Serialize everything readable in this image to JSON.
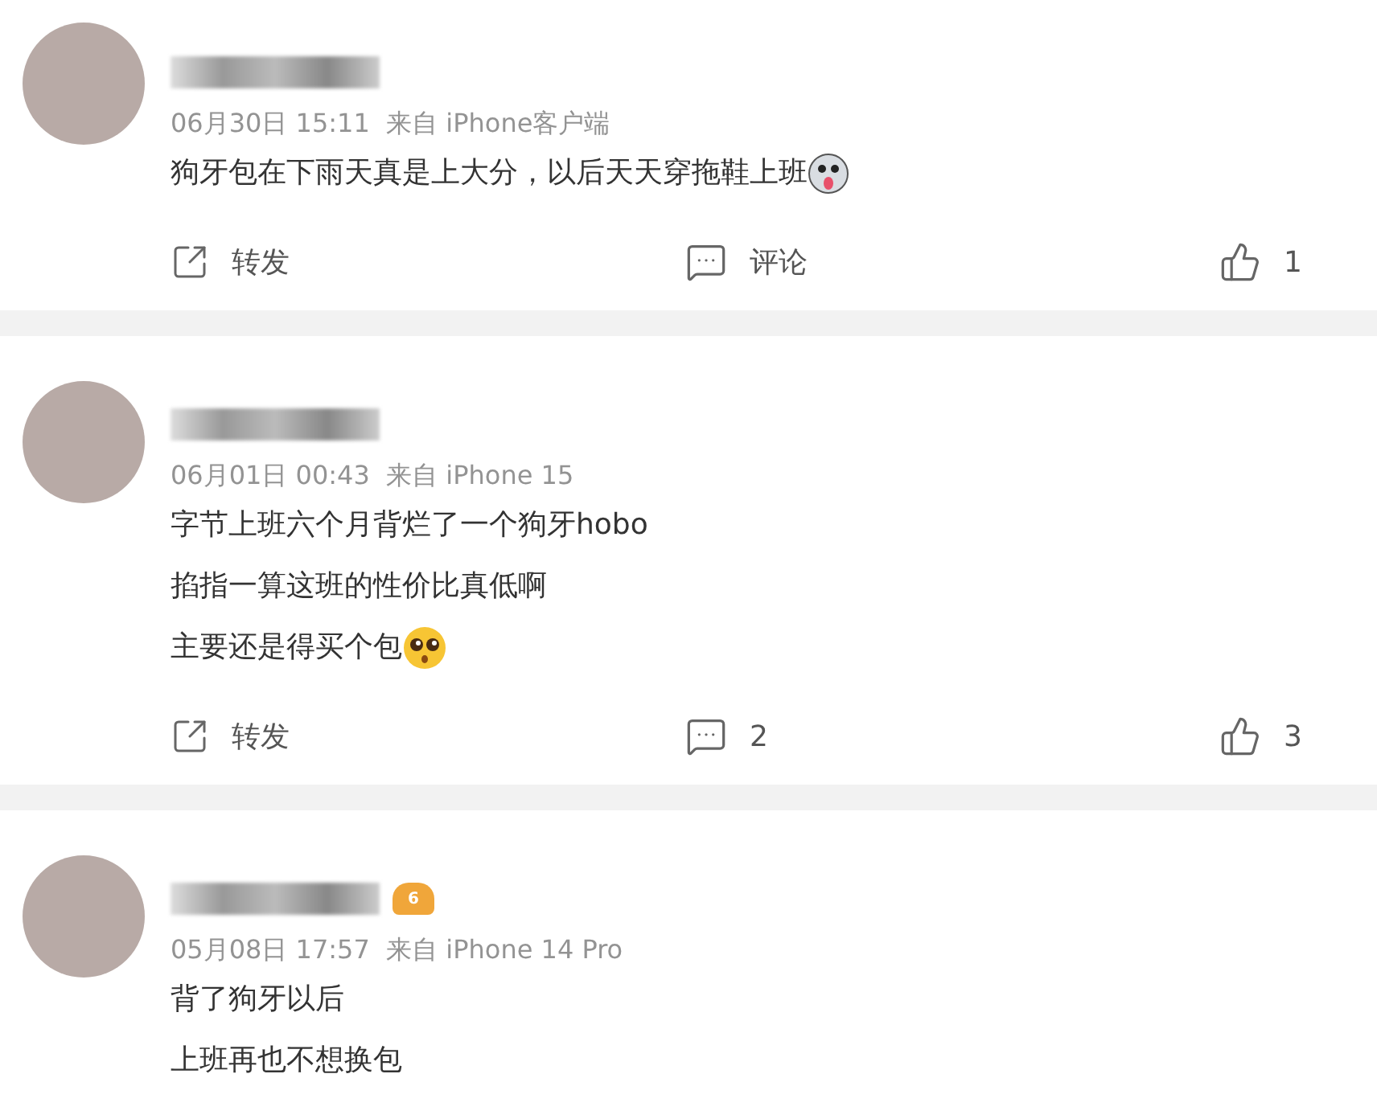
{
  "comments": [
    {
      "meta": "06月30日 15:11  来自 iPhone客户端",
      "lines": [
        {
          "text": "狗牙包在下雨天真是上大分，以后天天穿拖鞋上班",
          "kind": "dog"
        }
      ],
      "actions": {
        "repost": "转发",
        "comment": "评论",
        "likes": "1"
      }
    },
    {
      "meta": "06月01日 00:43  来自 iPhone 15",
      "lines": [
        {
          "text": "字节上班六个月背烂了一个狗牙hobo",
          "kind": "plain"
        },
        {
          "text": "掐指一算这班的性价比真低啊",
          "kind": "plain"
        },
        {
          "text": "主要还是得买个包",
          "kind": "pleading"
        }
      ],
      "actions": {
        "repost": "转发",
        "comment": "2",
        "likes": "3"
      }
    },
    {
      "badge": "6",
      "meta": "05月08日 17:57  来自 iPhone 14 Pro",
      "lines": [
        {
          "text": "背了狗牙以后",
          "kind": "plain"
        },
        {
          "text": "上班再也不想换包",
          "kind": "plain"
        }
      ]
    }
  ]
}
